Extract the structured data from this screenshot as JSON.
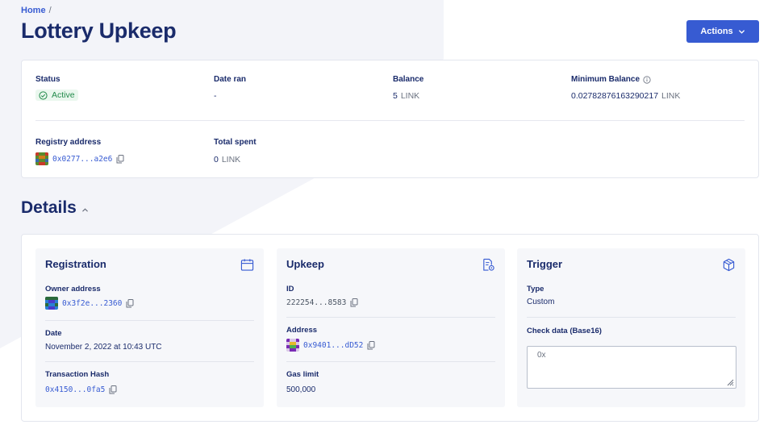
{
  "breadcrumb": {
    "home": "Home",
    "separator": "/"
  },
  "page": {
    "title": "Lottery Upkeep"
  },
  "actions": {
    "label": "Actions"
  },
  "summary": {
    "status": {
      "label": "Status",
      "value": "Active"
    },
    "date_ran": {
      "label": "Date ran",
      "value": "-"
    },
    "balance": {
      "label": "Balance",
      "amount": "5",
      "unit": "LINK"
    },
    "min_balance": {
      "label": "Minimum Balance",
      "amount": "0.02782876163290217",
      "unit": "LINK"
    },
    "registry": {
      "label": "Registry address",
      "value": "0x0277...a2e6"
    },
    "total_spent": {
      "label": "Total spent",
      "amount": "0",
      "unit": "LINK"
    }
  },
  "details": {
    "heading": "Details",
    "registration": {
      "title": "Registration",
      "owner_label": "Owner address",
      "owner_value": "0x3f2e...2360",
      "date_label": "Date",
      "date_value": "November 2, 2022 at 10:43 UTC",
      "tx_label": "Transaction Hash",
      "tx_value": "0x4150...0fa5"
    },
    "upkeep": {
      "title": "Upkeep",
      "id_label": "ID",
      "id_value": "222254...8583",
      "address_label": "Address",
      "address_value": "0x9401...dD52",
      "gas_label": "Gas limit",
      "gas_value": "500,000"
    },
    "trigger": {
      "title": "Trigger",
      "type_label": "Type",
      "type_value": "Custom",
      "check_label": "Check data (Base16)",
      "check_value": "0x"
    }
  },
  "colors": {
    "accent": "#375bd2",
    "navy": "#1a2b6b",
    "success": "#218a4a",
    "bg_shape": "#f3f4f9"
  },
  "icons": [
    "chevron-down-icon",
    "check-circle-icon",
    "info-icon",
    "copy-icon",
    "chevron-up-icon",
    "calendar-icon",
    "document-gear-icon",
    "cube-icon",
    "resize-grip-icon"
  ]
}
